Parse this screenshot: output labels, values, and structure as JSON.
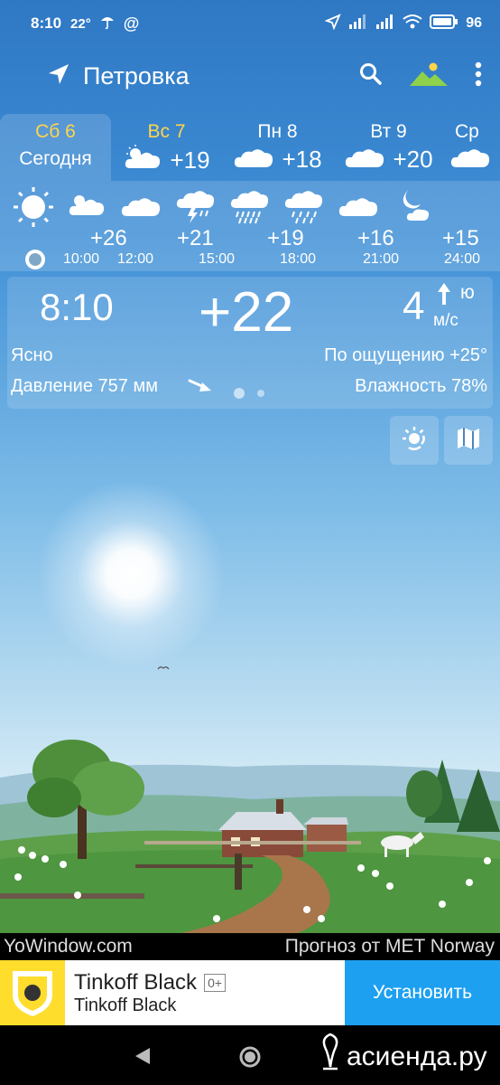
{
  "status_bar": {
    "time": "8:10",
    "temp": "22°",
    "battery": "96"
  },
  "header": {
    "location": "Петровка"
  },
  "days": [
    {
      "name": "Сб 6",
      "sub": "Сегодня",
      "icon": "sun-icon",
      "temp": ""
    },
    {
      "name": "Вс 7",
      "sub": "",
      "icon": "partly-cloudy-icon",
      "temp": "+19"
    },
    {
      "name": "Пн 8",
      "sub": "",
      "icon": "cloud-icon",
      "temp": "+18"
    },
    {
      "name": "Вт 9",
      "sub": "",
      "icon": "cloud-icon",
      "temp": "+20"
    },
    {
      "name": "Ср",
      "sub": "",
      "icon": "cloud-icon",
      "temp": ""
    }
  ],
  "hourly": {
    "temps": [
      "+26",
      "+21",
      "+19",
      "+16",
      "+15"
    ],
    "times": [
      "10:00",
      "12:00",
      "15:00",
      "18:00",
      "21:00",
      "24:00"
    ]
  },
  "current": {
    "time": "8:10",
    "temp": "+22",
    "wind_speed": "4",
    "wind_dir": "ю",
    "wind_unit": "м/с",
    "condition": "Ясно",
    "feels_like": "По ощущению +25°",
    "pressure": "Давление 757 мм",
    "humidity": "Влажность 78%"
  },
  "credits": {
    "left": "YoWindow.com",
    "right": "Прогноз от MET Norway"
  },
  "ad": {
    "title": "Tinkoff Black",
    "age": "0+",
    "subtitle": "Tinkoff Black",
    "button": "Установить"
  },
  "watermark": "асиенда.ру",
  "colors": {
    "today_accent": "#ffd54a",
    "install_button": "#1ea0f0",
    "ad_logo": "#ffdd2d"
  }
}
